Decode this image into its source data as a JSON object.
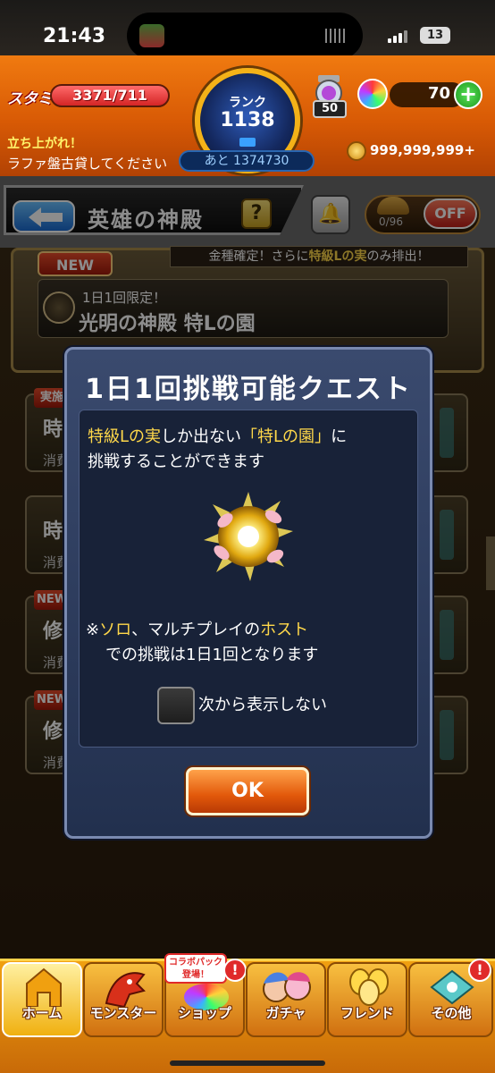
{
  "status_bar": {
    "time": "21:43",
    "battery": "13"
  },
  "header": {
    "stamina_label": "スタミナ",
    "stamina_value": "3371/711",
    "rank_label": "ランク",
    "rank_value": "1138",
    "rank_next": "あと 1374730",
    "gem_level": "50",
    "orb_count": "70",
    "slogan_1": "立ち上がれ！",
    "slogan_2": "ラファ盤古貸してください",
    "coins": "999,999,999+"
  },
  "temple": {
    "title": "英雄の神殿",
    "help": "?",
    "counter": "0/96",
    "toggle": "OFF",
    "new_tag": "NEW",
    "notice_prefix": "金種確定！さらに",
    "notice_highlight": "特級Lの実",
    "notice_suffix": "のみ排出！",
    "banner_sub": "1日1回限定！",
    "banner_title": "光明の神殿 特Lの園"
  },
  "list": [
    {
      "tag": "実施",
      "name": "時",
      "sub": "消費"
    },
    {
      "tag": "",
      "name": "時",
      "sub": "消費"
    },
    {
      "tag": "NEW",
      "name": "修",
      "sub": "消費"
    },
    {
      "tag": "NEW",
      "name": "修",
      "sub": "消費"
    }
  ],
  "dialog": {
    "title": "1日1回挑戦可能クエスト",
    "line1_highlight": "特級Lの実",
    "line1_mid": "しか出ない",
    "line1_highlight2": "「特Lの園」",
    "line1_end": "に",
    "line2": "挑戦することができます",
    "note1_prefix": "※",
    "note1_highlight": "ソロ",
    "note1_mid": "、マルチプレイの",
    "note1_highlight2": "ホスト",
    "note2": "での挑戦は1日1回となります",
    "checkbox_label": "次から表示しない",
    "ok_label": "OK"
  },
  "nav": {
    "collab_line1": "コラボパック",
    "collab_line2": "登場！",
    "items": [
      {
        "label": "ホーム"
      },
      {
        "label": "モンスター"
      },
      {
        "label": "ショップ"
      },
      {
        "label": "ガチャ"
      },
      {
        "label": "フレンド"
      },
      {
        "label": "その他"
      }
    ],
    "badge": "!"
  }
}
